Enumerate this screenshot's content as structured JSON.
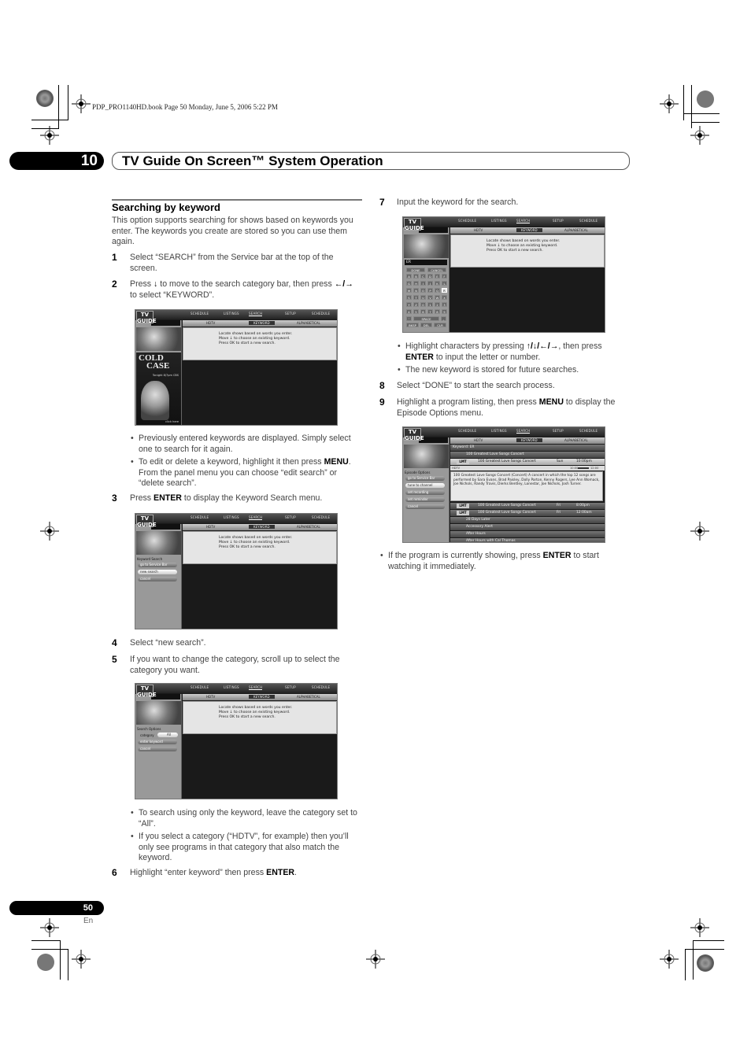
{
  "print_info": "PDP_PRO1140HD.book  Page 50  Monday, June 5, 2006  5:22 PM",
  "header": {
    "chapter_number": "10",
    "title": "TV Guide On Screen™ System Operation"
  },
  "section": {
    "heading": "Searching by keyword",
    "intro": "This option supports searching for shows based on keywords you enter. The keywords you create are stored so you can use them again."
  },
  "steps": [
    {
      "num": "1",
      "text": "Select “SEARCH” from the Service bar at the top of the screen."
    },
    {
      "num": "2",
      "text_a": "Press ",
      "icon1": "down-arrow-icon",
      "text_b": " to move to the search category bar, then press ",
      "icon2": "left-right-arrow-icon",
      "text_c": " to select “KEYWORD”."
    },
    {
      "num": "3",
      "text_a": "Press ",
      "bold": "ENTER",
      "text_b": " to display the Keyword Search menu."
    },
    {
      "num": "4",
      "text": "Select “new search”."
    },
    {
      "num": "5",
      "text": "If you want to change the category, scroll up to select the category you want."
    },
    {
      "num": "6",
      "text_a": "Highlight “enter keyword” then press ",
      "bold": "ENTER",
      "text_b": "."
    },
    {
      "num": "7",
      "text": "Input the keyword for the search."
    },
    {
      "num": "8",
      "text": "Select “DONE” to start the search process."
    },
    {
      "num": "9",
      "text_a": "Highlight a program listing, then press ",
      "bold": "MENU",
      "text_b": " to display the Episode Options menu."
    }
  ],
  "bullets": {
    "after_step2": [
      {
        "text": "Previously entered keywords are displayed. Simply select one to search for it again."
      },
      {
        "text_a": "To edit or delete a keyword, highlight it then press ",
        "bold": "MENU",
        "text_b": ". From the panel menu you can choose “edit search” or “delete search”."
      }
    ],
    "after_step5": [
      {
        "text": "To search using only the keyword, leave the category set to “All”."
      },
      {
        "text": "If you select a category (“HDTV”, for example) then you’ll only see programs in that category that also match the keyword."
      }
    ],
    "after_step7": [
      {
        "text_a": "Highlight characters by pressing ",
        "arrows": "↑/↓/←/→",
        "text_b": ", then press ",
        "bold": "ENTER",
        "text_c": " to input the letter or number."
      },
      {
        "text": "The new keyword is stored for future searches."
      }
    ],
    "after_step9": [
      {
        "text_a": "If the program is currently showing, press ",
        "bold": "ENTER",
        "text_b": " to start watching it immediately."
      }
    ]
  },
  "tvguide": {
    "logo": "TV GUIDE",
    "nav": [
      "SCHEDULE",
      "LISTINGS",
      "SEARCH",
      "SETUP",
      "SCHEDULE"
    ],
    "nav_selected": "SEARCH",
    "categories": [
      "HDTV",
      "KEYWORD",
      "ALPHABETICAL"
    ],
    "info_lines": [
      "Locate shows based on words you enter.",
      "Move ↓ to choose an existing keyword.",
      "Press OK to start a new search."
    ],
    "ad": {
      "title_1": "COLD",
      "title_2": "CASE",
      "sub": "Tonight 8/7pm CBS",
      "click": "click here"
    },
    "keyword_search_menu": {
      "title": "Keyword Search",
      "items": [
        "go to Service Bar",
        "new search",
        "cancel"
      ],
      "highlighted": "new search"
    },
    "search_options_menu": {
      "title": "Search Options",
      "category_label": "category",
      "category_value": "All",
      "items": [
        "enter keyword",
        "cancel"
      ]
    },
    "keyboard": {
      "input": "ER",
      "top": [
        "DONE",
        "CANCEL"
      ],
      "rows": [
        [
          "A",
          "B",
          "C",
          "D",
          "E",
          "F"
        ],
        [
          "G",
          "H",
          "I",
          "J",
          "K",
          "L"
        ],
        [
          "M",
          "N",
          "O",
          "P",
          "Q",
          "R"
        ],
        [
          "S",
          "T",
          "U",
          "V",
          "W",
          "X"
        ],
        [
          "Y",
          "Z",
          "0",
          "1",
          "2",
          "3"
        ],
        [
          "4",
          "5",
          "6",
          "7",
          "8",
          "9"
        ]
      ],
      "highlighted": "R",
      "space_row": [
        "'",
        "SPACE",
        ","
      ],
      "bottom": [
        "BKSP",
        "DEL",
        "CLR"
      ]
    },
    "results": {
      "keyword_label": "Keyword: ER",
      "group_title": "100 Greatest Love Songs Concert",
      "selected": {
        "badge": "LMT",
        "title": "100 Greatest Love Songs Concert",
        "day": "Sun",
        "time": "10:00pm",
        "channel": "HDTV",
        "progress_start": "10:00",
        "progress_end": "12:00"
      },
      "description": "100 Greatest Love Songs Concert (Concert) A concert in which the top 12 songs are performed by Sara Evans, Brad Paisley, Dolly Parton, Kenny Rogers, Lee Ann Womack, Joe Nichols, Randy Travis, Dierks Bentley, Lonestar, Joe Nichols, Josh Turner.",
      "rows": [
        {
          "badge": "LMT",
          "title": "100 Greatest Love Songs Concert",
          "day": "Fri",
          "time": "8:00pm"
        },
        {
          "badge": "LMT",
          "title": "100 Greatest Love Songs Concert",
          "day": "Fri",
          "time": "12:00am"
        }
      ],
      "other_titles": [
        "28 Days Later",
        "Accessory Alert",
        "After Hours",
        "After Hours with Cal Thomas"
      ]
    },
    "episode_options_menu": {
      "title": "Episode Options",
      "items": [
        "go to Service Bar",
        "tune to channel",
        "set recording",
        "set reminder",
        "cancel"
      ],
      "highlighted": "tune to channel"
    }
  },
  "footer": {
    "page_number": "50",
    "language": "En"
  }
}
